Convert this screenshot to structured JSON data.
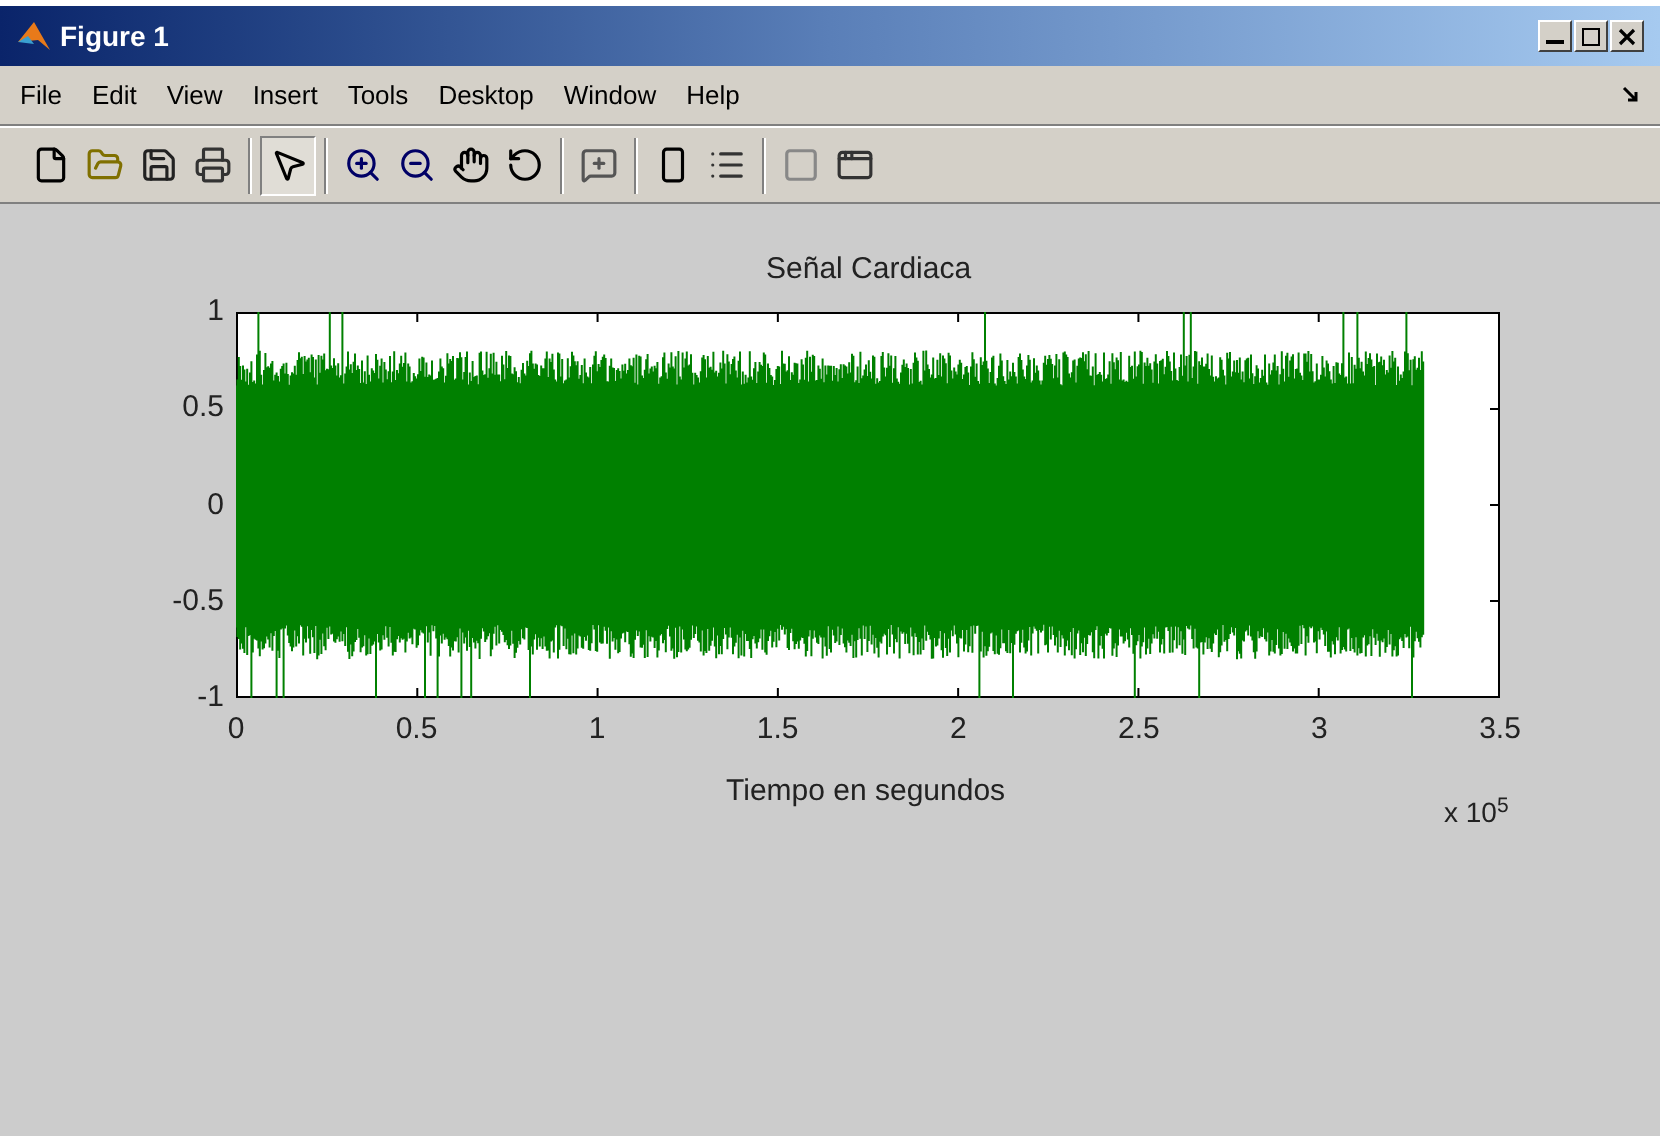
{
  "window": {
    "title": "Figure 1"
  },
  "menu": [
    "File",
    "Edit",
    "View",
    "Insert",
    "Tools",
    "Desktop",
    "Window",
    "Help"
  ],
  "toolbar": [
    [
      {
        "kind": "new",
        "selected": false
      },
      {
        "kind": "open",
        "selected": false
      },
      {
        "kind": "save",
        "selected": false
      },
      {
        "kind": "print",
        "selected": false
      }
    ],
    [
      {
        "kind": "pointer",
        "selected": true
      }
    ],
    [
      {
        "kind": "zoom-in",
        "selected": false
      },
      {
        "kind": "zoom-out",
        "selected": false
      },
      {
        "kind": "pan",
        "selected": false
      },
      {
        "kind": "rotate",
        "selected": false
      }
    ],
    [
      {
        "kind": "data-cursor",
        "selected": false
      }
    ],
    [
      {
        "kind": "colorbar",
        "selected": false
      },
      {
        "kind": "legend",
        "selected": false
      }
    ],
    [
      {
        "kind": "hide-tools",
        "selected": false
      },
      {
        "kind": "show-tools",
        "selected": false
      }
    ]
  ],
  "plot": {
    "title": "Señal Cardiaca",
    "xlabel": "Tiempo en segundos",
    "x_multiplier": "x 10$^{5}$",
    "xticks": [
      "0",
      "0.5",
      "1",
      "1.5",
      "2",
      "2.5",
      "3",
      "3.5"
    ],
    "yticks": [
      "1",
      "0.5",
      "0",
      "-0.5",
      "-1"
    ]
  }
}
